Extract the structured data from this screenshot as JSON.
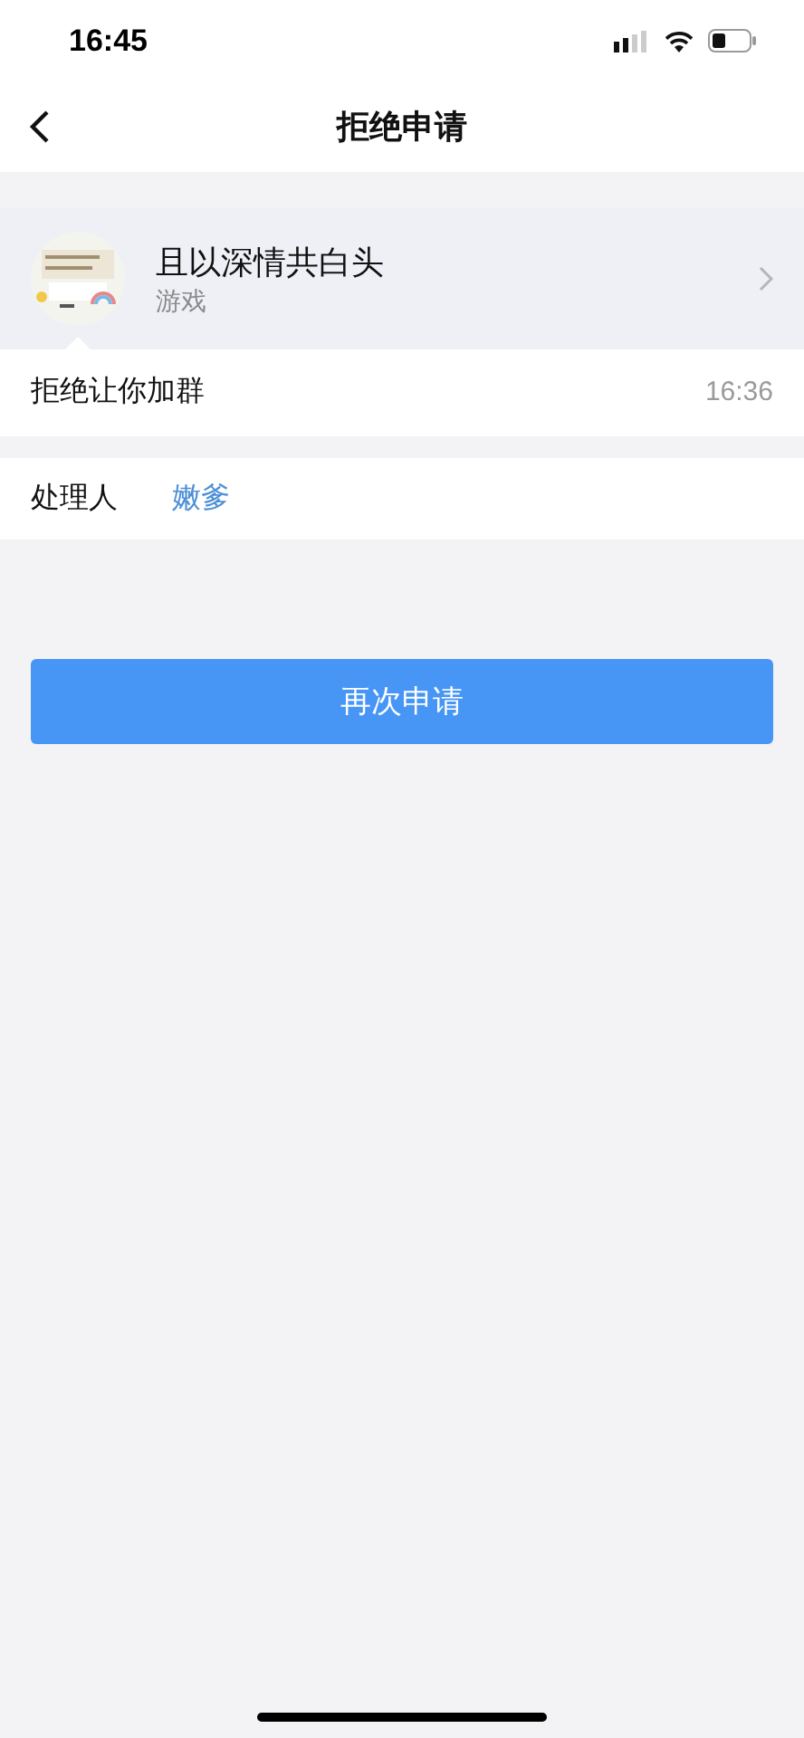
{
  "status_bar": {
    "time": "16:45"
  },
  "nav": {
    "title": "拒绝申请"
  },
  "group": {
    "name": "且以深情共白头",
    "category": "游戏"
  },
  "message": {
    "text": "拒绝让你加群",
    "time": "16:36"
  },
  "handler": {
    "label": "处理人",
    "name": "嫩爹"
  },
  "button": {
    "label": "再次申请"
  }
}
